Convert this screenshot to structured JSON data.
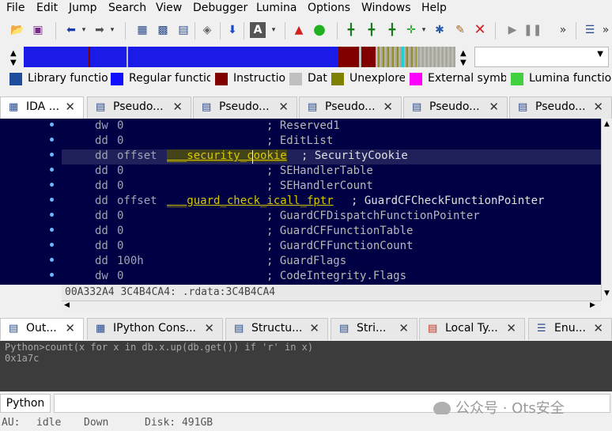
{
  "menu": [
    "File",
    "Edit",
    "Jump",
    "Search",
    "View",
    "Debugger",
    "Lumina",
    "Options",
    "Windows",
    "Help"
  ],
  "toolbar": {
    "icons": [
      "open-icon",
      "save-icon",
      "back-icon",
      "forward-icon",
      "binary-icon",
      "hex-icon",
      "struct-icon",
      "patch-icon",
      "jump-down-icon",
      "text-icon",
      "graph-icon",
      "run-green-icon",
      "code-icon",
      "code-add-icon",
      "code-a-icon",
      "function-add-icon",
      "bug-icon",
      "edit-icon",
      "delete-icon",
      "play-icon",
      "pause-icon",
      "more-icon",
      "debugger-settings-icon"
    ],
    "dropdown_value": ""
  },
  "legend": [
    {
      "label": "Library functio",
      "color": "#1f4c9c"
    },
    {
      "label": "Regular functio",
      "color": "#1010ff"
    },
    {
      "label": "Instructio",
      "color": "#800000"
    },
    {
      "label": "Dat",
      "color": "#c0c0c0"
    },
    {
      "label": "Unexplore",
      "color": "#808000"
    },
    {
      "label": "External symbo",
      "color": "#ff00ff"
    },
    {
      "label": "Lumina functio",
      "color": "#40d040"
    }
  ],
  "top_tabs": [
    {
      "label": "IDA ...",
      "icon": "ida-view-icon",
      "active": true
    },
    {
      "label": "Pseudo...",
      "icon": "pseudocode-icon",
      "active": false
    },
    {
      "label": "Pseudo...",
      "icon": "pseudocode-icon",
      "active": false
    },
    {
      "label": "Pseudo...",
      "icon": "pseudocode-icon",
      "active": false
    },
    {
      "label": "Pseudo...",
      "icon": "pseudocode-icon",
      "active": false
    },
    {
      "label": "Pseudo...",
      "icon": "pseudocode-icon",
      "active": false
    }
  ],
  "code_lines": [
    {
      "op": "dw",
      "val": "0",
      "comment": "; Reserved1",
      "sym": ""
    },
    {
      "op": "dd",
      "val": "0",
      "comment": "; EditList",
      "sym": ""
    },
    {
      "op": "dd",
      "val": "offset",
      "sym": "___security_cookie",
      "comment": "; SecurityCookie"
    },
    {
      "op": "dd",
      "val": "0",
      "comment": "; SEHandlerTable",
      "sym": ""
    },
    {
      "op": "dd",
      "val": "0",
      "comment": "; SEHandlerCount",
      "sym": ""
    },
    {
      "op": "dd",
      "val": "offset",
      "sym": "___guard_check_icall_fptr",
      "comment": "; GuardCFCheckFunctionPointer"
    },
    {
      "op": "dd",
      "val": "0",
      "comment": "; GuardCFDispatchFunctionPointer",
      "sym": ""
    },
    {
      "op": "dd",
      "val": "0",
      "comment": "; GuardCFFunctionTable",
      "sym": ""
    },
    {
      "op": "dd",
      "val": "0",
      "comment": "; GuardCFFunctionCount",
      "sym": ""
    },
    {
      "op": "dd",
      "val": "100h",
      "comment": "; GuardFlags",
      "sym": ""
    },
    {
      "op": "dw",
      "val": "0",
      "comment": "; CodeIntegrity.Flags",
      "sym": ""
    }
  ],
  "address_status": "00A332A4 3C4B4CA4: .rdata:3C4B4CA4",
  "bottom_tabs": [
    {
      "label": "Out...",
      "icon": "output-icon",
      "active": true
    },
    {
      "label": "IPython Cons...",
      "icon": "ipython-icon",
      "active": false
    },
    {
      "label": "Structu...",
      "icon": "structures-icon",
      "active": false
    },
    {
      "label": "Stri...",
      "icon": "strings-icon",
      "active": false
    },
    {
      "label": "Local Ty...",
      "icon": "local-types-icon",
      "active": false
    },
    {
      "label": "Enu...",
      "icon": "enums-icon",
      "active": false
    }
  ],
  "output_lines": [
    "Python>count(x for x in db.x.up(db.get()) if 'r' in x)",
    "0x1a7c"
  ],
  "cli": {
    "language": "Python",
    "value": ""
  },
  "status": {
    "au": "AU:",
    "state": "idle",
    "direction": "Down",
    "disk": "Disk: 491GB"
  },
  "watermark": "公众号 · Ots安全"
}
